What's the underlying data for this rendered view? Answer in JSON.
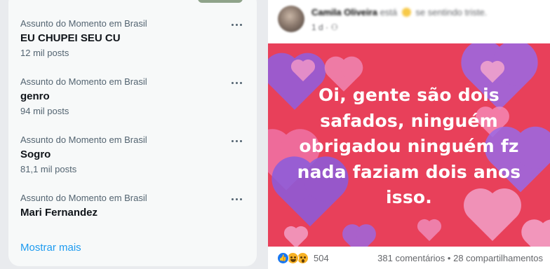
{
  "trends": {
    "items": [
      {
        "context": "Assunto do Momento em Brasil",
        "name": "EU CHUPEI SEU CU",
        "count": "12 mil posts"
      },
      {
        "context": "Assunto do Momento em Brasil",
        "name": "genro",
        "count": "94 mil posts"
      },
      {
        "context": "Assunto do Momento em Brasil",
        "name": "Sogro",
        "count": "81,1 mil posts"
      },
      {
        "context": "Assunto do Momento em Brasil",
        "name": "Mari Fernandez",
        "count": ""
      }
    ],
    "show_more_label": "Mostrar mais"
  },
  "post": {
    "author": "Camila Oliveira",
    "action_pre": "está",
    "action_post": "se sentindo triste.",
    "time": "1 d",
    "card_text": "Oi, gente são dois\nsafados, ninguém\nobrigadou ninguém fz\nnada  faziam dois anos\nisso.",
    "card_color": "#e8405a",
    "reactions": {
      "icons": [
        "like-icon",
        "haha-icon",
        "wow-icon"
      ],
      "count": "504"
    },
    "comments": "381 comentários",
    "shares": "28 compartilhamentos",
    "separator": "•"
  }
}
